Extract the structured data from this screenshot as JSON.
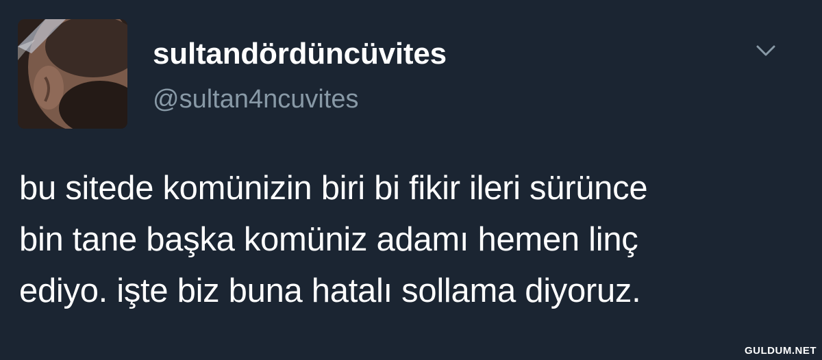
{
  "user": {
    "display_name": "sultandördüncüvites",
    "handle": "@sultan4ncuvites"
  },
  "tweet": {
    "text": "bu sitede komünizin biri bi fikir ileri sürünce\nbin tane başka komüniz adamı hemen linç\nediyo. işte biz buna hatalı sollama diyoruz."
  },
  "menu": {
    "icon": "chevron-down-icon"
  },
  "watermark": {
    "text": "GULDUM.NET"
  },
  "colors": {
    "background": "#1b2532",
    "text": "#ffffff",
    "secondary": "#8899a6"
  }
}
